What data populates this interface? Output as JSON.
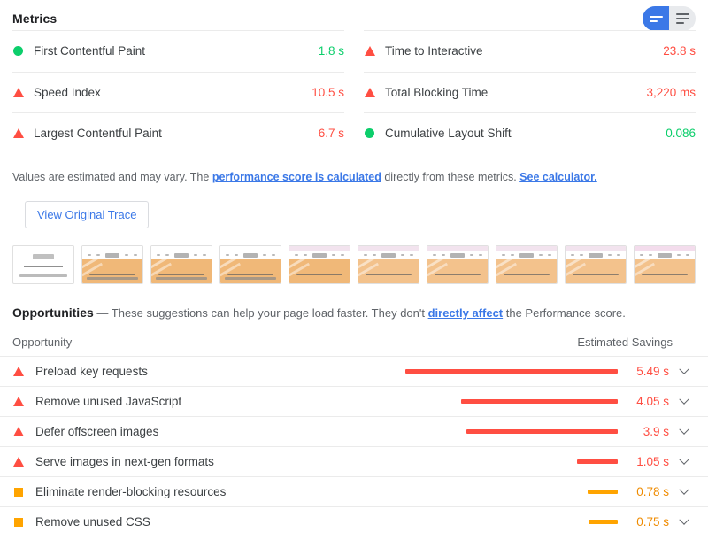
{
  "metrics_section": {
    "title": "Metrics",
    "view_toggle": {
      "compact_label": "compact-view",
      "expanded_label": "expanded-view",
      "active": "compact",
      "active_color": "#3b78e7",
      "inactive_color": "#e8eaed"
    },
    "left_column": [
      {
        "icon": "pass-circle-icon",
        "status": "pass",
        "name": "First Contentful Paint",
        "value": "1.8 s"
      },
      {
        "icon": "fail-triangle-icon",
        "status": "fail",
        "name": "Speed Index",
        "value": "10.5 s"
      },
      {
        "icon": "fail-triangle-icon",
        "status": "fail",
        "name": "Largest Contentful Paint",
        "value": "6.7 s"
      }
    ],
    "right_column": [
      {
        "icon": "fail-triangle-icon",
        "status": "fail",
        "name": "Time to Interactive",
        "value": "23.8 s"
      },
      {
        "icon": "fail-triangle-icon",
        "status": "fail",
        "name": "Total Blocking Time",
        "value": "3,220 ms"
      },
      {
        "icon": "pass-circle-icon",
        "status": "pass",
        "name": "Cumulative Layout Shift",
        "value": "0.086"
      }
    ]
  },
  "disclaimer": {
    "part1": "Values are estimated and may vary. The ",
    "link1": "performance score is calculated",
    "part2": " directly from these metrics. ",
    "link2": "See calculator."
  },
  "trace_button": {
    "label": "View Original Trace"
  },
  "filmstrip": {
    "frames": [
      {
        "type": "blank",
        "topbar": "#ffffff",
        "hero": "#ffffff"
      },
      {
        "type": "loaded",
        "topbar": "#ffffff",
        "hero": "#f0b878"
      },
      {
        "type": "loaded",
        "topbar": "#ffffff",
        "hero": "#f0b878"
      },
      {
        "type": "loaded",
        "topbar": "#ffffff",
        "hero": "#f0b878"
      },
      {
        "type": "loaded",
        "topbar": "#f2e3ee",
        "hero": "#f0b878"
      },
      {
        "type": "loaded",
        "topbar": "#f2e3ee",
        "hero": "#f3c28c"
      },
      {
        "type": "loaded",
        "topbar": "#f2e3ee",
        "hero": "#f3c28c"
      },
      {
        "type": "loaded",
        "topbar": "#f2e3ee",
        "hero": "#f3c28c"
      },
      {
        "type": "loaded",
        "topbar": "#f2e3ee",
        "hero": "#f3c28c"
      },
      {
        "type": "loaded",
        "topbar": "#f3dcec",
        "hero": "#f3c28c"
      }
    ]
  },
  "opportunities_section": {
    "title": "Opportunities",
    "dash": " — ",
    "intro_part1": "These suggestions can help your page load faster. They don't ",
    "intro_link": "directly affect",
    "intro_part2": " the Performance score.",
    "col_opportunity": "Opportunity",
    "col_savings": "Estimated Savings",
    "max_savings": 5.49,
    "rows": [
      {
        "icon": "fail-triangle-icon",
        "status": "fail",
        "name": "Preload key requests",
        "value": "5.49 s",
        "seconds": 5.49,
        "chevron": "chevron-down-icon"
      },
      {
        "icon": "fail-triangle-icon",
        "status": "fail",
        "name": "Remove unused JavaScript",
        "value": "4.05 s",
        "seconds": 4.05,
        "chevron": "chevron-down-icon"
      },
      {
        "icon": "fail-triangle-icon",
        "status": "fail",
        "name": "Defer offscreen images",
        "value": "3.9 s",
        "seconds": 3.9,
        "chevron": "chevron-down-icon"
      },
      {
        "icon": "fail-triangle-icon",
        "status": "fail",
        "name": "Serve images in next-gen formats",
        "value": "1.05 s",
        "seconds": 1.05,
        "chevron": "chevron-down-icon"
      },
      {
        "icon": "avg-square-icon",
        "status": "average",
        "name": "Eliminate render-blocking resources",
        "value": "0.78 s",
        "seconds": 0.78,
        "chevron": "chevron-down-icon"
      },
      {
        "icon": "avg-square-icon",
        "status": "average",
        "name": "Remove unused CSS",
        "value": "0.75 s",
        "seconds": 0.75,
        "chevron": "chevron-down-icon"
      }
    ]
  },
  "colors": {
    "pass": "#0cce6b",
    "fail": "#ff4e42",
    "average": "#ffa400",
    "average_text": "#ef8b00",
    "link": "#3b78e7"
  }
}
